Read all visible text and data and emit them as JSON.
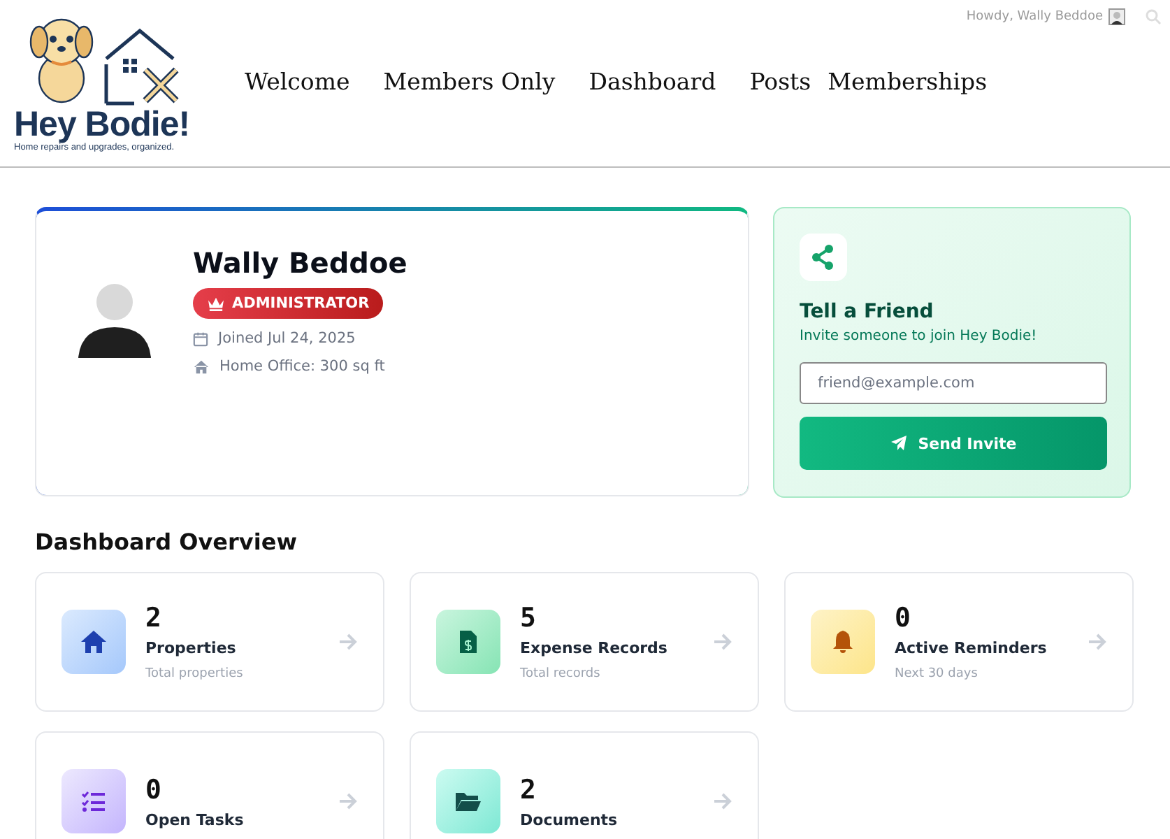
{
  "header": {
    "logo": {
      "name": "Hey Bodie!",
      "tagline": "Home repairs and upgrades, organized."
    },
    "nav": [
      {
        "label": "Welcome"
      },
      {
        "label": "Members Only"
      },
      {
        "label": "Dashboard"
      },
      {
        "label": "Posts"
      },
      {
        "label": "Memberships"
      }
    ],
    "greeting": "Howdy, Wally Beddoe"
  },
  "profile": {
    "name": "Wally Beddoe",
    "role": "ADMINISTRATOR",
    "joined": "Joined Jul 24, 2025",
    "office": "Home Office: 300 sq ft"
  },
  "invite": {
    "title": "Tell a Friend",
    "subtitle": "Invite someone to join Hey Bodie!",
    "placeholder": "friend@example.com",
    "button": "Send Invite"
  },
  "overview": {
    "title": "Dashboard Overview",
    "cards": [
      {
        "kind": "properties",
        "count": "2",
        "label": "Properties",
        "note": "Total properties"
      },
      {
        "kind": "expenses",
        "count": "5",
        "label": "Expense Records",
        "note": "Total records"
      },
      {
        "kind": "reminders",
        "count": "0",
        "label": "Active Reminders",
        "note": "Next 30 days"
      },
      {
        "kind": "tasks",
        "count": "0",
        "label": "Open Tasks"
      },
      {
        "kind": "documents",
        "count": "2",
        "label": "Documents"
      }
    ]
  }
}
